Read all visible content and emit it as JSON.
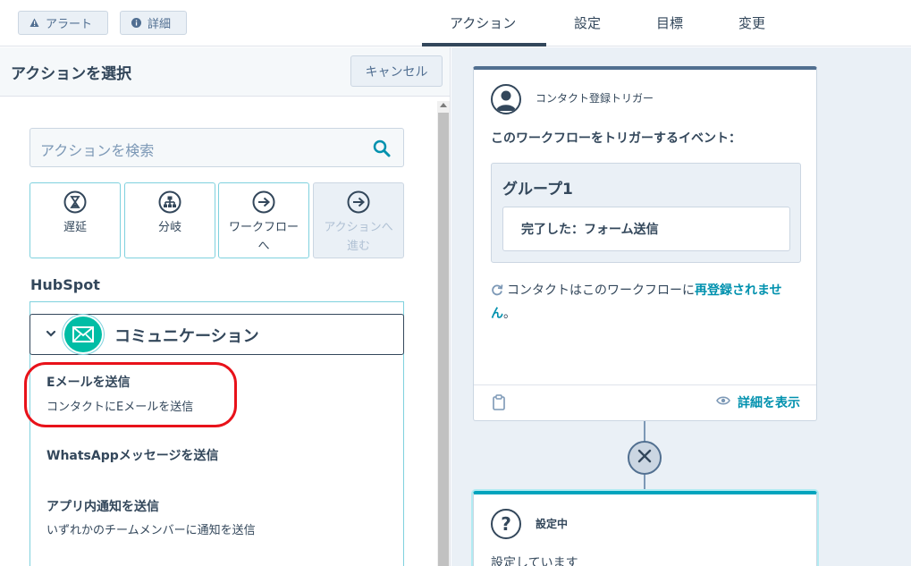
{
  "topbar": {
    "alert_label": "アラート",
    "details_label": "詳細",
    "tabs": [
      {
        "label": "アクション",
        "active": true
      },
      {
        "label": "設定",
        "active": false
      },
      {
        "label": "目標",
        "active": false
      },
      {
        "label": "変更",
        "active": false
      }
    ]
  },
  "left_panel": {
    "title": "アクションを選択",
    "cancel_label": "キャンセル",
    "search_placeholder": "アクションを検索",
    "tiles": [
      {
        "label": "遅延",
        "icon": "hourglass-icon",
        "disabled": false
      },
      {
        "label": "分岐",
        "icon": "branch-icon",
        "disabled": false
      },
      {
        "label": "ワークフロー\nへ",
        "icon": "arrow-right-circle-icon",
        "disabled": false
      },
      {
        "label": "アクションへ\n進む",
        "icon": "arrow-right-circle-icon",
        "disabled": true
      }
    ],
    "section_title": "HubSpot",
    "category": {
      "label": "コミュニケーション",
      "icon": "envelope-icon",
      "expanded": true
    },
    "items": [
      {
        "title": "Eメールを送信",
        "subtitle": "コンタクトにEメールを送信",
        "highlighted": true
      },
      {
        "title": "WhatsAppメッセージを送信",
        "subtitle": ""
      },
      {
        "title": "アプリ内通知を送信",
        "subtitle": "いずれかのチームメンバーに通知を送信"
      }
    ]
  },
  "canvas": {
    "trigger_card": {
      "type_label": "コンタクト登録トリガー",
      "event_label": "このワークフローをトリガーするイベント：",
      "group_title": "グループ1",
      "condition": "完了した：フォーム送信",
      "reenroll_prefix": "コンタクトはこのワークフローに",
      "reenroll_link": "再登録されません",
      "reenroll_suffix": "。",
      "view_details_label": "詳細を表示"
    },
    "setting_card": {
      "title": "設定中",
      "body": "設定しています"
    }
  },
  "colors": {
    "accent_teal": "#00a4bd",
    "link": "#0091ae",
    "highlight_oval": "#e8121a",
    "mail_green": "#00bda5"
  }
}
